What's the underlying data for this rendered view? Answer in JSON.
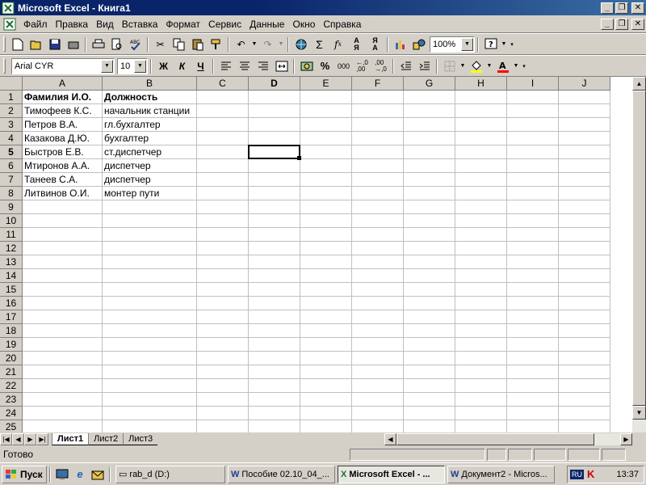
{
  "window": {
    "title": "Microsoft Excel - Книга1"
  },
  "menu": {
    "items": [
      "Файл",
      "Правка",
      "Вид",
      "Вставка",
      "Формат",
      "Сервис",
      "Данные",
      "Окно",
      "Справка"
    ]
  },
  "toolbar": {
    "zoom": "100%"
  },
  "format_toolbar": {
    "font": "Arial CYR",
    "size": "10",
    "bold_label": "Ж",
    "italic_label": "К",
    "underline_label": "Ч",
    "percent_label": "%",
    "thousands_label": "000"
  },
  "sheet": {
    "columns": [
      "A",
      "B",
      "C",
      "D",
      "E",
      "F",
      "G",
      "H",
      "I",
      "J"
    ],
    "active_column": "D",
    "active_row": 5,
    "row_numbers": [
      "1",
      "2",
      "3",
      "4",
      "5",
      "6",
      "7",
      "8",
      "9",
      "10",
      "11",
      "12",
      "13",
      "14",
      "15",
      "16",
      "17",
      "18",
      "19",
      "20",
      "21",
      "22",
      "23",
      "24",
      "25"
    ],
    "rows": [
      {
        "a": "Фамилия И.О.",
        "b": "Должность"
      },
      {
        "a": "Тимофеев К.С.",
        "b": "начальник станции"
      },
      {
        "a": "Петров В.А.",
        "b": "гл.бухгалтер"
      },
      {
        "a": "Казакова Д.Ю.",
        "b": "бухгалтер"
      },
      {
        "a": "Быстров Е.В.",
        "b": "ст.диспетчер"
      },
      {
        "a": "Мтиронов А.А.",
        "b": "диспетчер"
      },
      {
        "a": "Танеев С.А.",
        "b": "диспетчер"
      },
      {
        "a": "Литвинов О.И.",
        "b": "монтер пути"
      }
    ]
  },
  "tabs": [
    "Лист1",
    "Лист2",
    "Лист3"
  ],
  "status": {
    "text": "Готово"
  },
  "taskbar": {
    "start_label": "Пуск",
    "items": [
      {
        "label": "rab_d (D:)"
      },
      {
        "label": "Пособие 02.10_04_..."
      },
      {
        "label": "Microsoft Excel - ..."
      },
      {
        "label": "Документ2 - Micros..."
      }
    ],
    "lang": "RU",
    "clock": "13:37"
  }
}
